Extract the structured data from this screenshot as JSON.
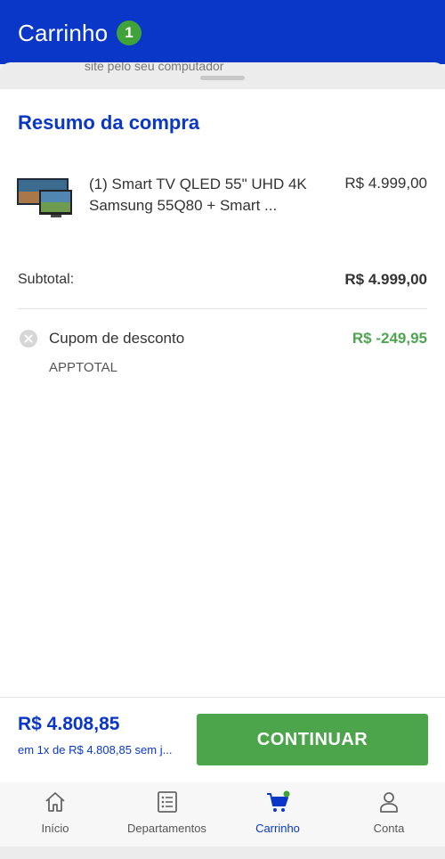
{
  "header": {
    "title": "Carrinho",
    "badge": "1"
  },
  "peek_text": "site pelo seu computador",
  "summary": {
    "title": "Resumo da compra",
    "item": {
      "name": "(1) Smart TV QLED 55\" UHD 4K Samsung 55Q80 + Smart ...",
      "price": "R$ 4.999,00"
    },
    "subtotal_label": "Subtotal:",
    "subtotal_value": "R$ 4.999,00",
    "coupon_label": "Cupom de desconto",
    "coupon_value": "R$ -249,95",
    "coupon_code": "APPTOTAL"
  },
  "footer": {
    "total": "R$ 4.808,85",
    "installments": "em 1x de R$ 4.808,85 sem j...",
    "continue_label": "CONTINUAR"
  },
  "nav": [
    {
      "label": "Início",
      "icon": "home-icon"
    },
    {
      "label": "Departamentos",
      "icon": "list-icon"
    },
    {
      "label": "Carrinho",
      "icon": "cart-icon",
      "active": true
    },
    {
      "label": "Conta",
      "icon": "user-icon"
    }
  ],
  "colors": {
    "brand_blue": "#0a37c8",
    "green": "#4ca44b",
    "badge_green": "#3fa33a"
  }
}
